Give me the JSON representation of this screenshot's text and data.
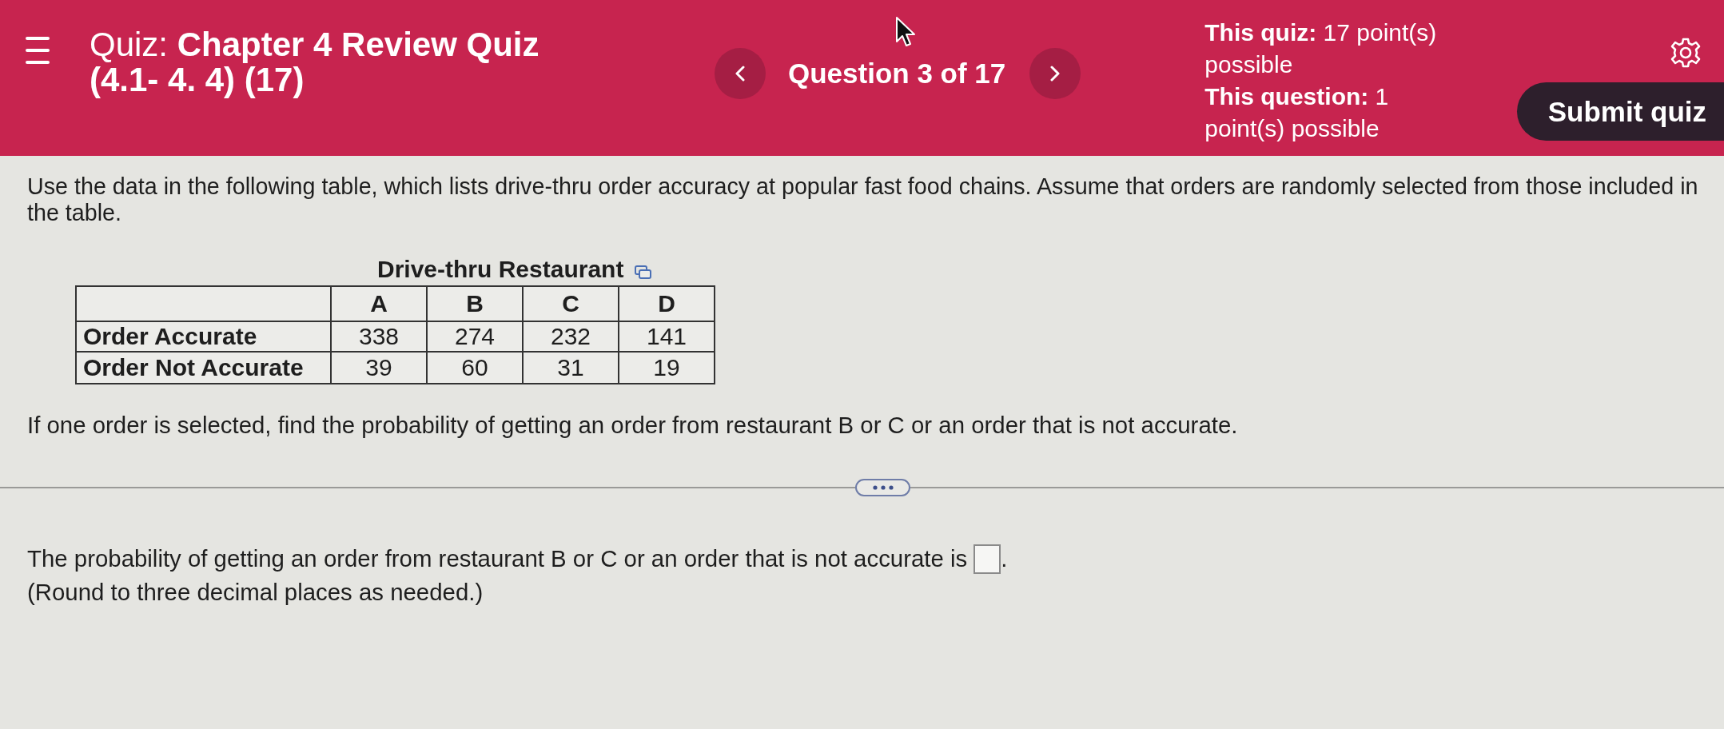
{
  "header": {
    "title": "Quiz: **Chapter 4 Review Quiz (4.1- 4. 4) (17)**",
    "question_position": "Question 3 of 17",
    "points": [
      "**This quiz:** 17 point(s) possible",
      "**This question:** 1 point(s) possible"
    ],
    "submit_button": "Submit quiz"
  },
  "question": {
    "intro": "Use the data in the following table, which lists drive-thru order accuracy at popular fast food chains. Assume that orders are randomly selected from those included in the table.",
    "table": {
      "caption": "Drive-thru Restaurant",
      "columns": [
        "A",
        "B",
        "C",
        "D"
      ],
      "rows": [
        {
          "label": "Order Accurate",
          "cells": [
            "338",
            "274",
            "232",
            "141"
          ]
        },
        {
          "label": "Order Not Accurate",
          "cells": [
            "39",
            "60",
            "31",
            "19"
          ]
        }
      ]
    },
    "prompt": "If one order is selected, find the probability of getting an order from restaurant B or C or an order that is not accurate."
  },
  "answer": {
    "sentence": "The probability of getting an order from restaurant B or C or an order that is not accurate is",
    "sentence_end": ".",
    "note": "(Round to three decimal places as needed.)"
  }
}
